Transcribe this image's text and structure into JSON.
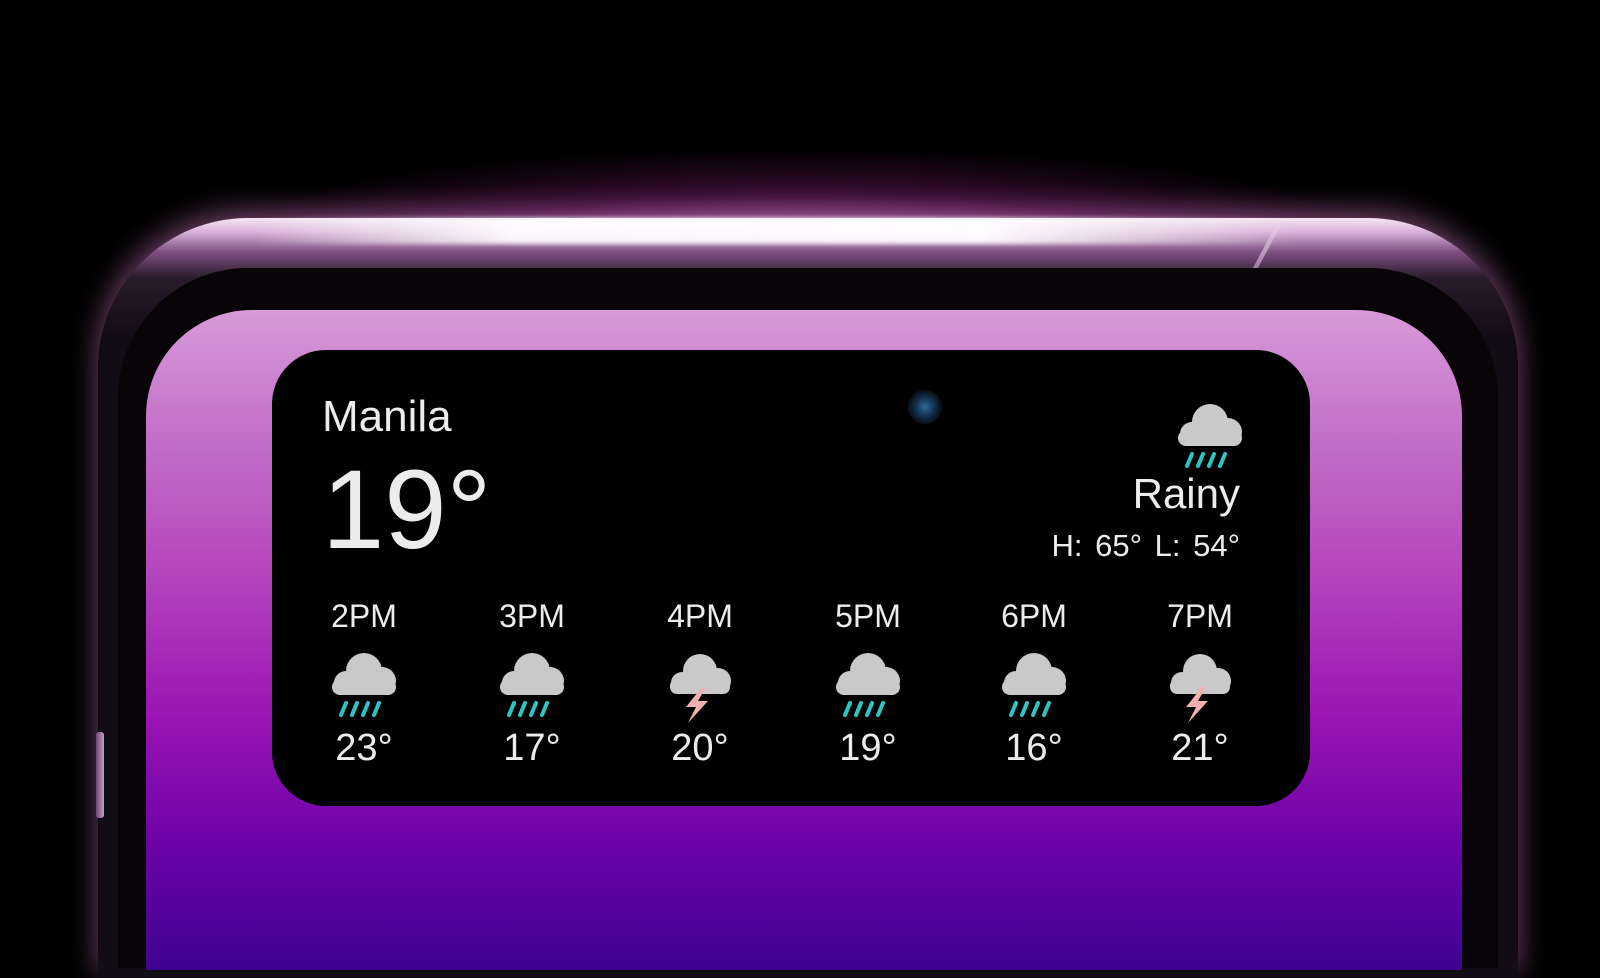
{
  "widget": {
    "city": "Manila",
    "current_temp": "19°",
    "condition": "Rainy",
    "high_low": "H: 65°  L: 54°",
    "condition_icon": "cloud-rain-icon"
  },
  "forecast": [
    {
      "time": "2PM",
      "temp": "23°",
      "icon": "cloud-rain-icon"
    },
    {
      "time": "3PM",
      "temp": "17°",
      "icon": "cloud-rain-icon"
    },
    {
      "time": "4PM",
      "temp": "20°",
      "icon": "cloud-lightning-icon"
    },
    {
      "time": "5PM",
      "temp": "19°",
      "icon": "cloud-rain-icon"
    },
    {
      "time": "6PM",
      "temp": "16°",
      "icon": "cloud-rain-icon"
    },
    {
      "time": "7PM",
      "temp": "21°",
      "icon": "cloud-lightning-icon"
    }
  ],
  "colors": {
    "cloud": "#c9c9c9",
    "rain": "#2ec4c4",
    "lightning": "#f4b0b0",
    "screen_top": "#d89ad8",
    "screen_bottom": "#3e0290"
  }
}
